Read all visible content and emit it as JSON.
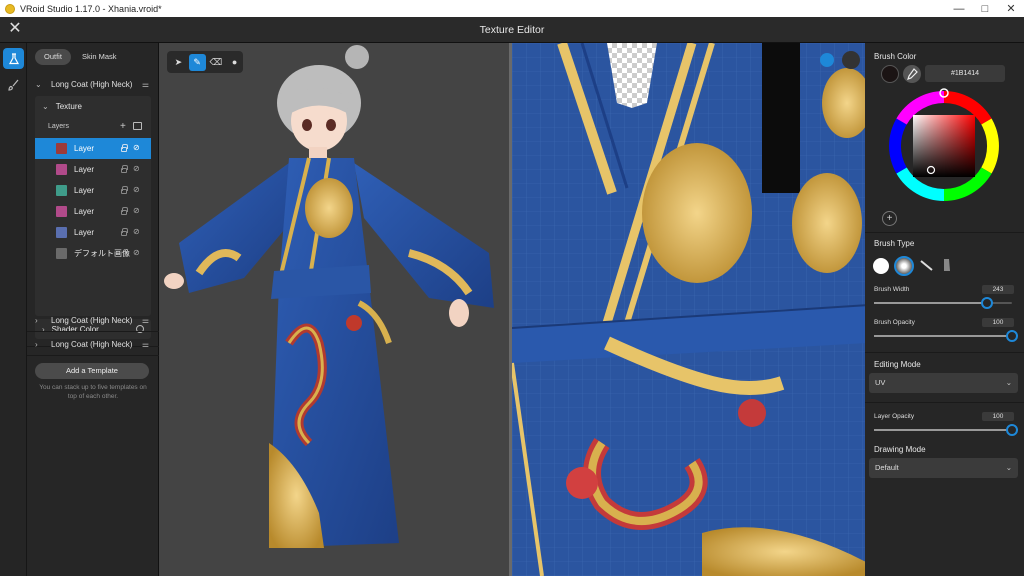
{
  "window": {
    "title": "VRoid Studio 1.17.0 - Xhania.vroid*",
    "minimize_glyph": "—",
    "maximize_glyph": "□",
    "close_glyph": "✕"
  },
  "header": {
    "title": "Texture Editor",
    "close_glyph": "✕"
  },
  "left_panel": {
    "tabs": [
      {
        "label": "Outfit",
        "active": true
      },
      {
        "label": "Skin Mask",
        "active": false
      }
    ],
    "item_group": {
      "title": "Long Coat (High Neck)",
      "texture": {
        "title": "Texture",
        "layers_label": "Layers",
        "add_glyph": "+",
        "layers": [
          {
            "label": "Layer",
            "color": "#9c3b3b",
            "selected": true
          },
          {
            "label": "Layer",
            "color": "#b14a8a",
            "selected": false
          },
          {
            "label": "Layer",
            "color": "#3f9c8a",
            "selected": false
          },
          {
            "label": "Layer",
            "color": "#b14a8a",
            "selected": false
          },
          {
            "label": "Layer",
            "color": "#5a6fb0",
            "selected": false
          },
          {
            "label": "デフォルト画像",
            "color": "#6a6a6a",
            "selected": false
          }
        ]
      },
      "shader_color": "Shader Color"
    },
    "collapsed_groups": [
      {
        "title": "Long Coat (High Neck)"
      },
      {
        "title": "Long Coat (High Neck)"
      }
    ],
    "add_template": "Add a Template",
    "template_hint": "You can stack up to five templates on top of each other."
  },
  "viewport3d": {
    "tools": [
      {
        "name": "select-tool-icon",
        "glyph": "➤",
        "active": false
      },
      {
        "name": "pen-tool-icon",
        "glyph": "✎",
        "active": true
      },
      {
        "name": "eraser-tool-icon",
        "glyph": "⌫",
        "active": false
      },
      {
        "name": "fill-tool-icon",
        "glyph": "●",
        "active": false
      }
    ]
  },
  "right_panel": {
    "brush_color_label": "Brush Color",
    "hex_value": "#1B1414",
    "add_color_glyph": "+",
    "brush_type_label": "Brush Type",
    "brush_width_label": "Brush Width",
    "brush_width_value": "243",
    "brush_width_level": 0.82,
    "brush_opacity_label": "Brush Opacity",
    "brush_opacity_value": "100",
    "brush_opacity_level": 1.0,
    "editing_mode_label": "Editing Mode",
    "editing_mode_value": "UV",
    "layer_opacity_label": "Layer Opacity",
    "layer_opacity_value": "100",
    "layer_opacity_level": 1.0,
    "drawing_mode_label": "Drawing Mode",
    "drawing_mode_value": "Default",
    "caret_glyph": "⌄"
  },
  "colors": {
    "accent": "#1e88d8",
    "brush_color": "#1b1414"
  }
}
